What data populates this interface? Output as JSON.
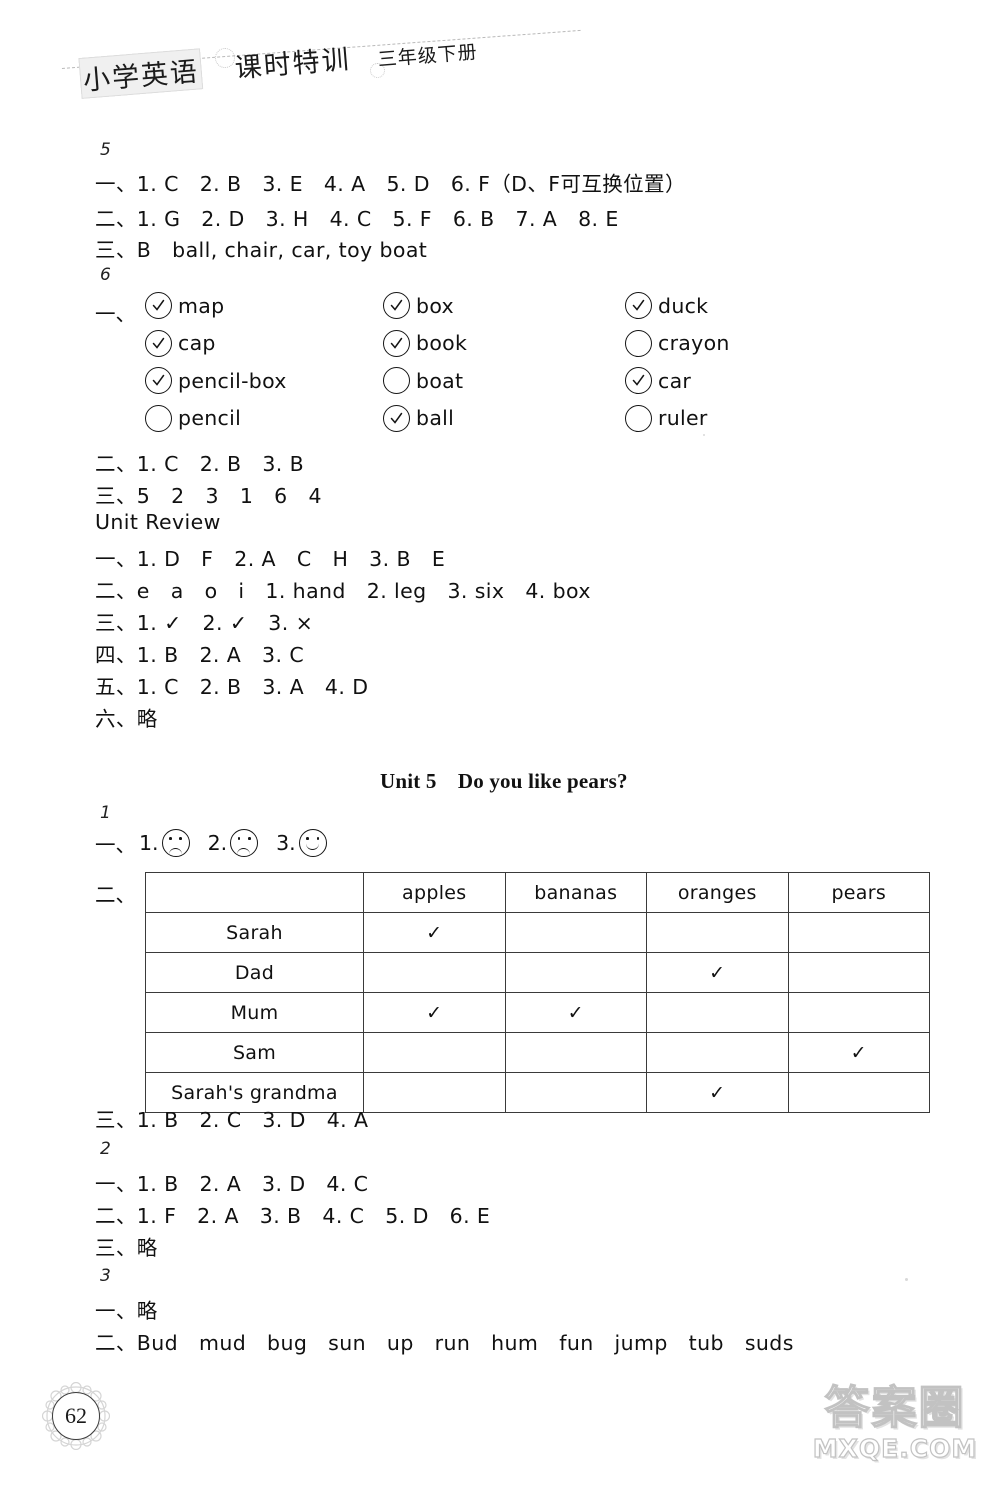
{
  "header": {
    "title_main": "小学英语",
    "title_sub": "课时特训",
    "title_grade": "三年级下册"
  },
  "sections": {
    "lesson5": {
      "marker": "5",
      "lines": [
        "一、1. C　2. B　3. E　4. A　5. D　6. F（D、F可互换位置）",
        "二、1. G　2. D　3. H　4. C　5. F　6. B　7. A　8. E",
        "三、B　ball, chair, car, toy boat"
      ]
    },
    "lesson6": {
      "marker": "6",
      "exercise_one_lead": "一、",
      "checklist": {
        "columns": [
          [
            {
              "label": "map",
              "checked": true
            },
            {
              "label": "cap",
              "checked": true
            },
            {
              "label": "pencil-box",
              "checked": true
            },
            {
              "label": "pencil",
              "checked": false
            }
          ],
          [
            {
              "label": "box",
              "checked": true
            },
            {
              "label": "book",
              "checked": true
            },
            {
              "label": "boat",
              "checked": false
            },
            {
              "label": "ball",
              "checked": true
            }
          ],
          [
            {
              "label": "duck",
              "checked": true
            },
            {
              "label": "crayon",
              "checked": false
            },
            {
              "label": "car",
              "checked": true
            },
            {
              "label": "ruler",
              "checked": false
            }
          ]
        ]
      },
      "lines": [
        "二、1. C　2. B　3. B",
        "三、5　2　3　1　6　4"
      ]
    },
    "unit_review": {
      "title": "Unit Review",
      "lines": [
        "一、1. D　F　2. A　C　H　3. B　E",
        "二、e　a　o　i　1. hand　2. leg　3. six　4. box",
        "三、1. ✓　2. ✓　3. ×",
        "四、1. B　2. A　3. C",
        "五、1. C　2. B　3. A　4. D",
        "六、略"
      ]
    },
    "unit5": {
      "heading": "Unit 5　Do you like pears?",
      "lesson1": {
        "marker": "1",
        "faces_lead": "一、",
        "faces": [
          {
            "number": "1.",
            "mood": "sad"
          },
          {
            "number": "2.",
            "mood": "sad"
          },
          {
            "number": "3.",
            "mood": "happy"
          }
        ],
        "table_lead": "二、",
        "table": {
          "columns": [
            "",
            "apples",
            "bananas",
            "oranges",
            "pears"
          ],
          "rows": [
            {
              "name": "Sarah",
              "marks": [
                true,
                false,
                false,
                false
              ]
            },
            {
              "name": "Dad",
              "marks": [
                false,
                false,
                true,
                false
              ]
            },
            {
              "name": "Mum",
              "marks": [
                true,
                true,
                false,
                false
              ]
            },
            {
              "name": "Sam",
              "marks": [
                false,
                false,
                false,
                true
              ]
            },
            {
              "name": "Sarah's grandma",
              "marks": [
                false,
                false,
                true,
                false
              ]
            }
          ],
          "tick_glyph": "✓"
        },
        "line_three": "三、1. B　2. C　3. D　4. A"
      },
      "lesson2": {
        "marker": "2",
        "lines": [
          "一、1. B　2. A　3. D　4. C",
          "二、1. F　2. A　3. B　4. C　5. D　6. E",
          "三、略"
        ]
      },
      "lesson3": {
        "marker": "3",
        "lines": [
          "一、略",
          "二、Bud　mud　bug　sun　up　run　hum　fun　jump　tub　suds"
        ]
      }
    }
  },
  "footer": {
    "page_number": "62",
    "watermark_cn": "答案圈",
    "watermark_en": "MXQE.COM"
  }
}
